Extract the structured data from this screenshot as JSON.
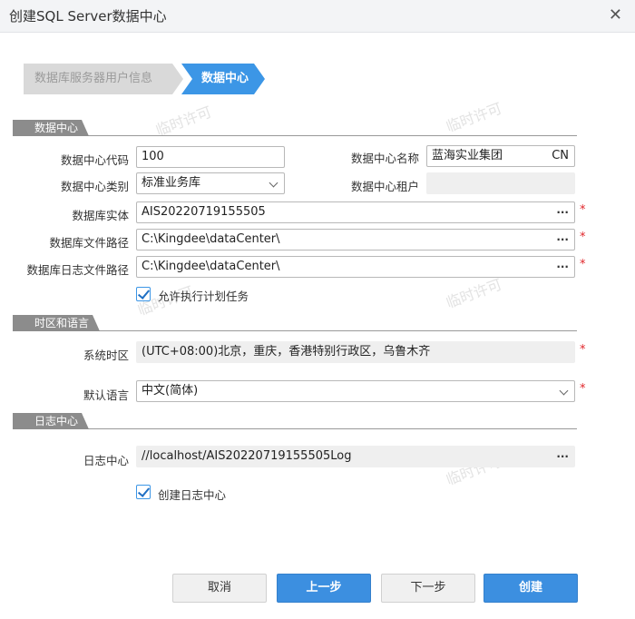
{
  "window": {
    "title": "创建SQL Server数据中心",
    "close_glyph": "✕"
  },
  "steps": [
    {
      "label": "数据库服务器用户信息"
    },
    {
      "label": "数据中心"
    }
  ],
  "watermark": "临时许可",
  "sections": {
    "datacenter": "数据中心",
    "timezone": "时区和语言",
    "log": "日志中心"
  },
  "fields": {
    "code": {
      "label": "数据中心代码",
      "value": "100"
    },
    "name": {
      "label": "数据中心名称",
      "value": "蓝海实业集团",
      "suffix": "CN"
    },
    "category": {
      "label": "数据中心类别",
      "value": "标准业务库"
    },
    "tenant": {
      "label": "数据中心租户",
      "value": ""
    },
    "db_entity": {
      "label": "数据库实体",
      "value": "AIS20220719155505"
    },
    "db_file_path": {
      "label": "数据库文件路径",
      "value": "C:\\Kingdee\\dataCenter\\"
    },
    "db_log_path": {
      "label": "数据库日志文件路径",
      "value": "C:\\Kingdee\\dataCenter\\"
    },
    "allow_tasks": {
      "label": "允许执行计划任务",
      "checked": true
    },
    "timezone": {
      "label": "系统时区",
      "value": "(UTC+08:00)北京，重庆，香港特别行政区，乌鲁木齐"
    },
    "language": {
      "label": "默认语言",
      "value": "中文(简体)"
    },
    "log_center": {
      "label": "日志中心",
      "value": "//localhost/AIS20220719155505Log"
    },
    "create_log": {
      "label": "创建日志中心",
      "checked": true
    }
  },
  "ellipsis": "···",
  "required_mark": "*",
  "buttons": {
    "cancel": "取消",
    "prev": "上一步",
    "next": "下一步",
    "create": "创建"
  }
}
